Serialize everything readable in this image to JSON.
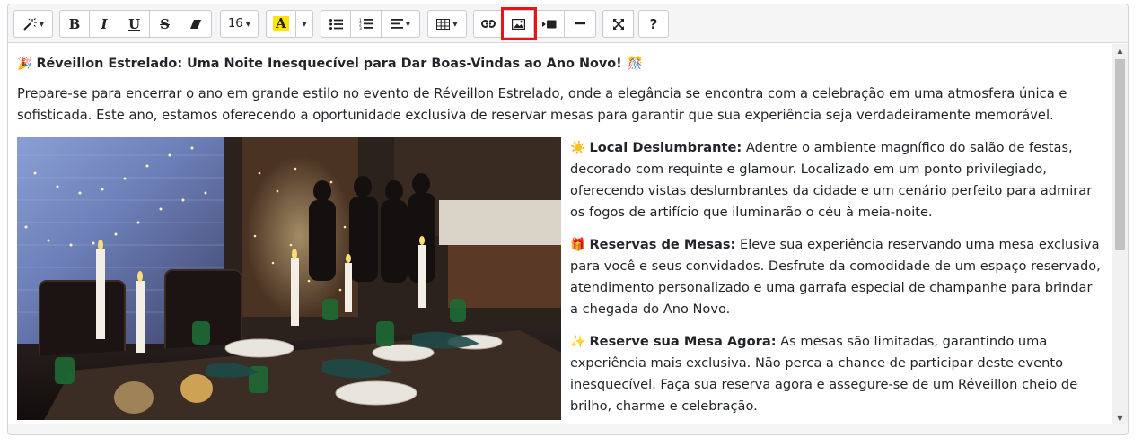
{
  "toolbar": {
    "magic_icon": "magic-wand-icon",
    "bold_label": "B",
    "italic_label": "I",
    "underline_label": "U",
    "strike_label": "S",
    "font_size": "16",
    "highlight_label": "A",
    "help_label": "?",
    "highlight_color": "#ffe400",
    "selected_tool_outline": "#e8141a"
  },
  "content": {
    "heading": "Réveillon Estrelado: Uma Noite Inesquecível para Dar Boas-Vindas ao Ano Novo!",
    "heading_emoji_left": "🎉",
    "heading_emoji_right": "🎊",
    "intro": "Prepare-se para encerrar o ano em grande estilo no evento de Réveillon Estrelado, onde a elegância se encontra com a celebração em uma atmosfera única e sofisticada. Este ano, estamos oferecendo a oportunidade exclusiva de reservar mesas para garantir que sua experiência seja verdadeiramente memorável.",
    "features": [
      {
        "emoji": "☀️",
        "title": "Local Deslumbrante:",
        "text": " Adentre o ambiente magnífico do salão de festas, decorado com requinte e glamour. Localizado em um ponto privilegiado, oferecendo vistas deslumbrantes da cidade e um cenário perfeito para admirar os fogos de artifício que iluminarão o céu à meia-noite."
      },
      {
        "emoji": "🎁",
        "title": "Reservas de Mesas:",
        "text": " Eleve sua experiência reservando uma mesa exclusiva para você e seus convidados. Desfrute da comodidade de um espaço reservado, atendimento personalizado e uma garrafa especial de champanhe para brindar a chegada do Ano Novo."
      },
      {
        "emoji": "✨",
        "title": "Reserve sua Mesa Agora:",
        "text": " As mesas são limitadas, garantindo uma experiência mais exclusiva. Não perca a chance de participar deste evento inesquecível. Faça sua reserva agora e assegure-se de um Réveillon cheio de brilho, charme e celebração."
      }
    ]
  }
}
